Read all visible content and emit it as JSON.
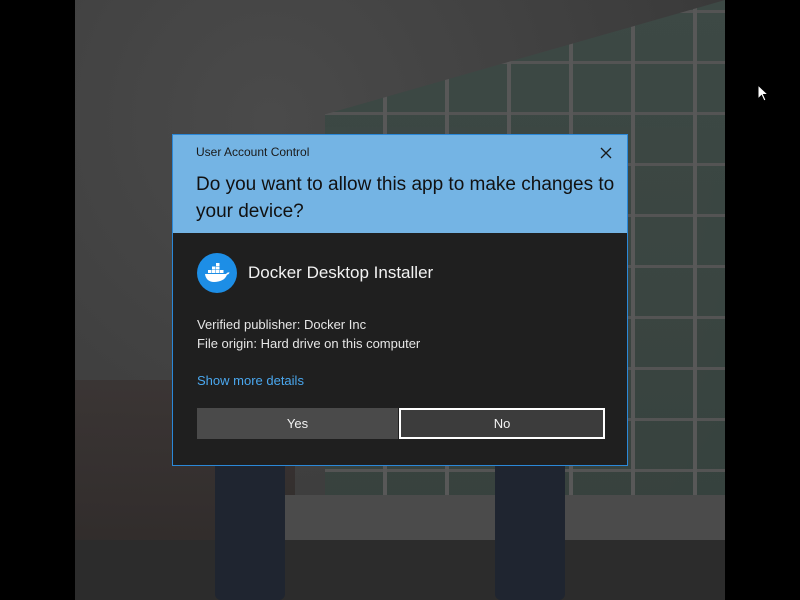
{
  "dialog": {
    "caption": "User Account Control",
    "question": "Do you want to allow this app to make changes to your device?",
    "app_name": "Docker Desktop Installer",
    "publisher": "Verified publisher: Docker Inc",
    "origin": "File origin: Hard drive on this computer",
    "more_details": "Show more details",
    "yes_label": "Yes",
    "no_label": "No",
    "header_color": "#74b4e4",
    "body_color": "#1f1f1f",
    "link_color": "#4aa7ee",
    "close_icon": "close-icon",
    "app_icon": "docker-whale-icon"
  }
}
